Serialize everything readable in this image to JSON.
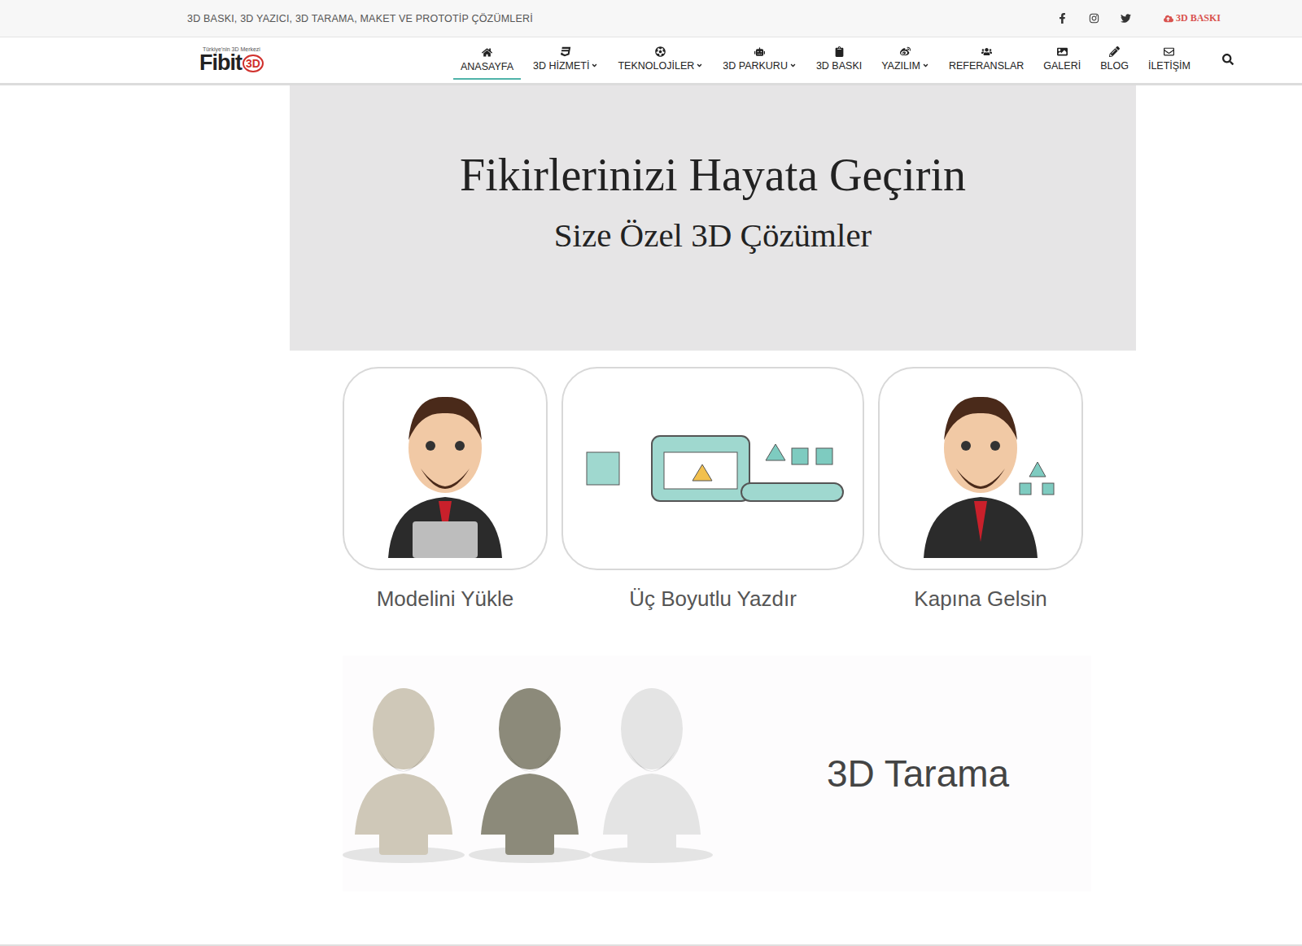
{
  "top_bar": {
    "tagline": "3D BASKI, 3D YAZICI, 3D TARAMA, MAKET VE PROTOTİP ÇÖZÜMLERİ",
    "cta": "3D BASKI"
  },
  "logo": {
    "tagline": "Türkiye'nin 3D Merkezi",
    "name": "Fibit",
    "mark": "3D"
  },
  "nav": [
    {
      "label": "ANASAYFA",
      "dropdown": false,
      "selected": true
    },
    {
      "label": "3D HİZMETİ",
      "dropdown": true,
      "selected": false
    },
    {
      "label": "TEKNOLOJİLER",
      "dropdown": true,
      "selected": false
    },
    {
      "label": "3D PARKURU",
      "dropdown": true,
      "selected": false
    },
    {
      "label": "3D BASKI",
      "dropdown": false,
      "selected": false
    },
    {
      "label": "YAZILIM",
      "dropdown": true,
      "selected": false
    },
    {
      "label": "REFERANSLAR",
      "dropdown": false,
      "selected": false
    },
    {
      "label": "GALERİ",
      "dropdown": false,
      "selected": false
    },
    {
      "label": "BLOG",
      "dropdown": false,
      "selected": false
    },
    {
      "label": "İLETİŞİM",
      "dropdown": false,
      "selected": false
    }
  ],
  "hero": {
    "title": "Fikirlerinizi Hayata Geçirin",
    "subtitle": "Size Özel 3D Çözümler"
  },
  "steps": [
    {
      "label": "Modelini Yükle"
    },
    {
      "label": "Üç Boyutlu Yazdır"
    },
    {
      "label": "Kapına Gelsin"
    }
  ],
  "feature": {
    "title": "3D Tarama"
  }
}
